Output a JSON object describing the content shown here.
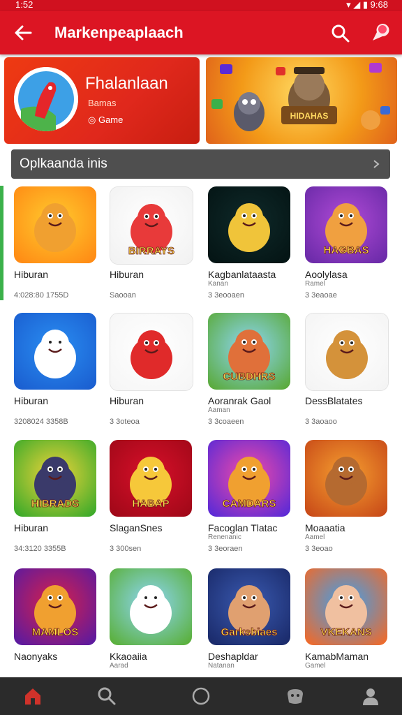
{
  "status": {
    "time": "1:52",
    "right": "▾ ◢ ▮ 9:68"
  },
  "appbar": {
    "title": "Markenpeaplaach"
  },
  "banner": {
    "title": "Fhalanlaan",
    "subtitle": "Bamas",
    "game": "Game"
  },
  "section": {
    "label": "Oplkaanda inis"
  },
  "apps": [
    {
      "name": "Hiburan",
      "sub1": "",
      "sub2": "4:028:80   1755D"
    },
    {
      "name": "Hiburan",
      "sub1": "",
      "sub2": "Saooan"
    },
    {
      "name": "Kagbanlataasta",
      "sub1": "Kanan",
      "sub2": "3 3eooaen"
    },
    {
      "name": "Aoolylasa",
      "sub1": "Ramel",
      "sub2": "3 3eaoae"
    },
    {
      "name": "Hiburan",
      "sub1": "",
      "sub2": "3208024   3358B"
    },
    {
      "name": "Hiburan",
      "sub1": "",
      "sub2": "3 3oteoa"
    },
    {
      "name": "Aoranrak Gaol",
      "sub1": "Aaman",
      "sub2": "3 3coaeen"
    },
    {
      "name": "DessBlatates",
      "sub1": "",
      "sub2": "3 3aoaoo"
    },
    {
      "name": "Hiburan",
      "sub1": "",
      "sub2": "34:3120   3355B"
    },
    {
      "name": "SlaganSnes",
      "sub1": "",
      "sub2": "3 300sen"
    },
    {
      "name": "Facoglan Tlatac",
      "sub1": "Renenanic",
      "sub2": "3 3eoraen"
    },
    {
      "name": "Moaaatia",
      "sub1": "Aamel",
      "sub2": "3 3eoao"
    },
    {
      "name": "Naonyaks",
      "sub1": "",
      "sub2": ""
    },
    {
      "name": "Kkaoaiia",
      "sub1": "Aarad",
      "sub2": ""
    },
    {
      "name": "Deshapldar",
      "sub1": "Natanan",
      "sub2": ""
    },
    {
      "name": "KamabMaman",
      "sub1": "Gamel",
      "sub2": ""
    }
  ],
  "tiles": [
    {
      "bg1": "#ffcb2e",
      "bg2": "#ff8a14",
      "fig": "#f0a030",
      "text": ""
    },
    {
      "bg1": "#ffffff",
      "bg2": "#f2f2f2",
      "fig": "#e83a3a",
      "text": "BIRRAYS"
    },
    {
      "bg1": "#0f2a2a",
      "bg2": "#041414",
      "fig": "#f0c43a",
      "text": ""
    },
    {
      "bg1": "#b04bd6",
      "bg2": "#6a2aa8",
      "fig": "#f0a040",
      "text": "HAGBAS"
    },
    {
      "bg1": "#2a8ef2",
      "bg2": "#1a5ed0",
      "fig": "#ffffff",
      "text": ""
    },
    {
      "bg1": "#ffffff",
      "bg2": "#f6f6f6",
      "fig": "#e02a2a",
      "text": ""
    },
    {
      "bg1": "#8ed6f6",
      "bg2": "#5aaa3a",
      "fig": "#e0703a",
      "text": "CUBDHRS"
    },
    {
      "bg1": "#ffffff",
      "bg2": "#f4f4f4",
      "fig": "#d4923a",
      "text": ""
    },
    {
      "bg1": "#f0d43a",
      "bg2": "#3aaa2a",
      "fig": "#3a3a6a",
      "text": "HIBRADS"
    },
    {
      "bg1": "#d8102a",
      "bg2": "#a00818",
      "fig": "#f6c83a",
      "text": "HABAP"
    },
    {
      "bg1": "#f24aa8",
      "bg2": "#5a2ad6",
      "fig": "#f0a030",
      "text": "CAMDARS"
    },
    {
      "bg1": "#f6a030",
      "bg2": "#c84a18",
      "fig": "#b56a30",
      "text": ""
    },
    {
      "bg1": "#d8204a",
      "bg2": "#5a1aa0",
      "fig": "#f0a030",
      "text": "MAMLOS"
    },
    {
      "bg1": "#8ed6f6",
      "bg2": "#5ab03a",
      "fig": "#ffffff",
      "text": ""
    },
    {
      "bg1": "#3a5ab0",
      "bg2": "#1a2a6a",
      "fig": "#e0a070",
      "text": "Garksbiaes"
    },
    {
      "bg1": "#3aa0f0",
      "bg2": "#f06a2a",
      "fig": "#f0c0a0",
      "text": "VKEKANS"
    }
  ],
  "colors": {
    "appbar": "#dc1523",
    "nav": "#2b2b2b",
    "navActive": "#d0322a"
  }
}
